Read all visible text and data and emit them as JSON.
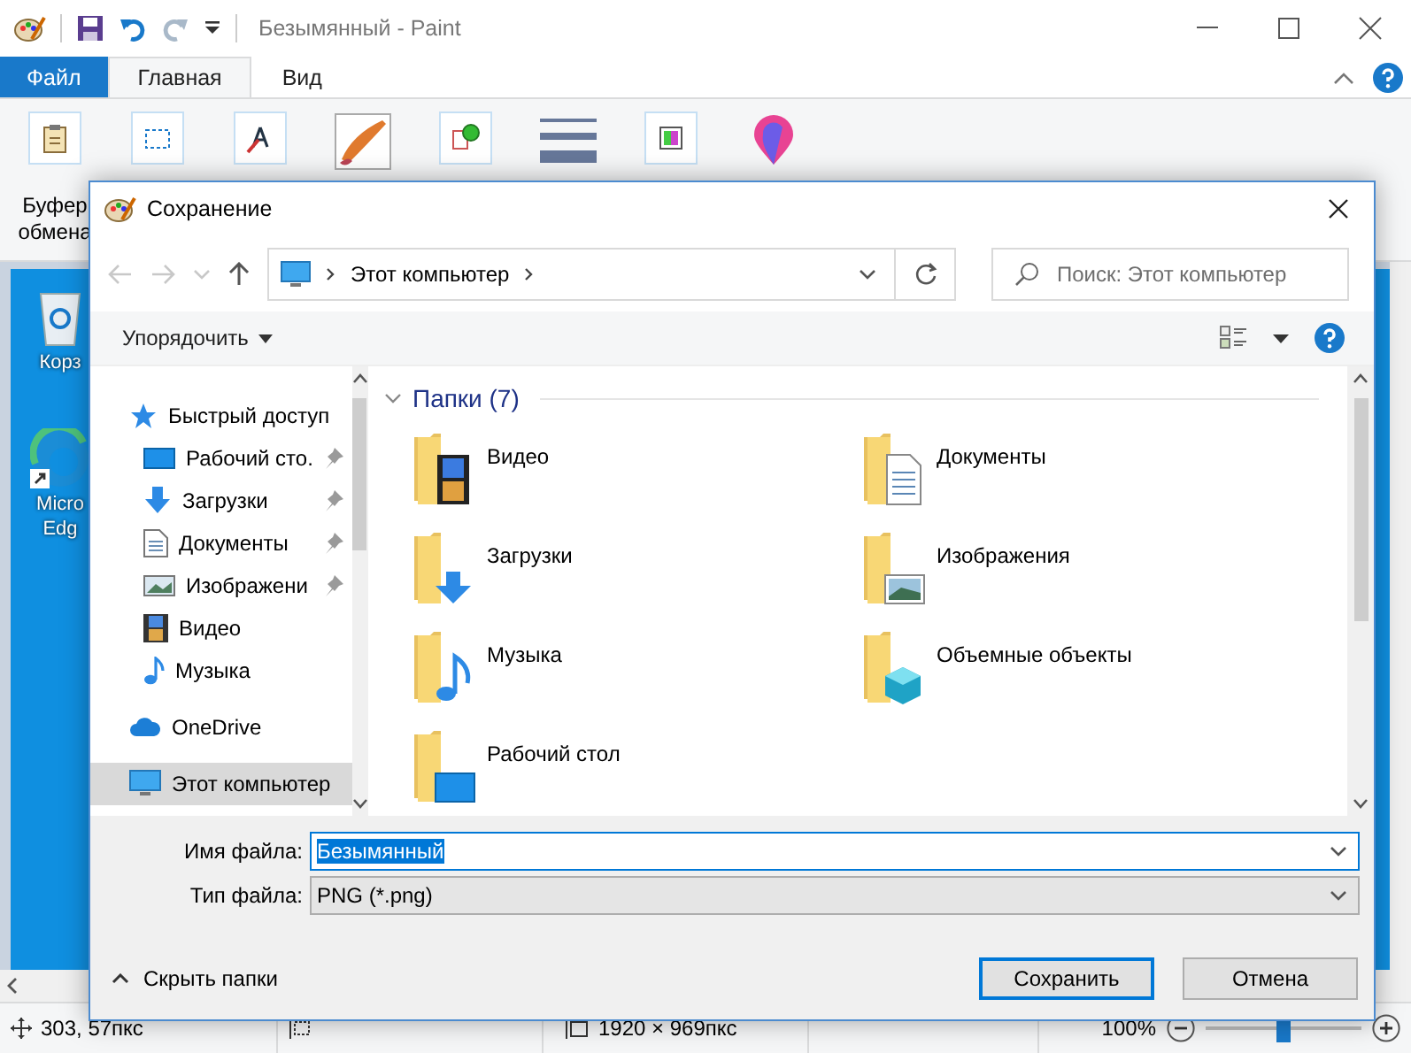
{
  "paint": {
    "title": "Безымянный - Paint",
    "tabs": [
      {
        "label": "Файл",
        "kind": "file",
        "selected": false
      },
      {
        "label": "Главная",
        "kind": "tab",
        "selected": true
      },
      {
        "label": "Вид",
        "kind": "tab",
        "selected": false
      }
    ],
    "ribbon_groups": [
      {
        "kind": "clipboard",
        "label": "Буфер обмена"
      },
      {
        "kind": "select"
      },
      {
        "kind": "tools"
      },
      {
        "kind": "brush"
      },
      {
        "kind": "shapes"
      },
      {
        "kind": "thickness"
      },
      {
        "kind": "colors"
      },
      {
        "kind": "paint3d"
      }
    ],
    "desktop_icons": [
      {
        "kind": "bin",
        "label": "Корз"
      },
      {
        "kind": "edge",
        "label": "Micro Edg"
      }
    ],
    "status_bar": {
      "cursor": "303, 57пкс",
      "canvas_size": "1920 × 969пкс",
      "zoom": "100%",
      "zoom_slider": {
        "level": 0.5
      }
    }
  },
  "dialog": {
    "title": "Сохранение",
    "address": "Этот компьютер",
    "search": {
      "placeholder": "Поиск: Этот компьютер"
    },
    "organize": "Упорядочить",
    "nav_tree": [
      {
        "label": "Быстрый доступ",
        "kind": "star",
        "selected": false,
        "children": [
          {
            "label": "Рабочий сто.",
            "kind": "desktop",
            "pinned": true,
            "selected": false
          },
          {
            "label": "Загрузки",
            "kind": "download",
            "pinned": true,
            "selected": false
          },
          {
            "label": "Документы",
            "kind": "document",
            "pinned": true,
            "selected": false
          },
          {
            "label": "Изображени",
            "kind": "pictures",
            "pinned": true,
            "selected": false
          },
          {
            "label": "Видео",
            "kind": "video",
            "pinned": false,
            "selected": false
          },
          {
            "label": "Музыка",
            "kind": "music",
            "pinned": false,
            "selected": false
          }
        ]
      },
      {
        "label": "OneDrive",
        "kind": "cloud",
        "selected": false
      },
      {
        "label": "Этот компьютер",
        "kind": "computer",
        "selected": true
      }
    ],
    "section": {
      "label": "Папки (7)",
      "expanded": true
    },
    "folders": [
      {
        "label": "Видео",
        "kind": "video"
      },
      {
        "label": "Документы",
        "kind": "document"
      },
      {
        "label": "Загрузки",
        "kind": "download"
      },
      {
        "label": "Изображения",
        "kind": "pictures"
      },
      {
        "label": "Музыка",
        "kind": "music"
      },
      {
        "label": "Объемные объекты",
        "kind": "objects3d"
      },
      {
        "label": "Рабочий стол",
        "kind": "desktop"
      }
    ],
    "file_name": {
      "label": "Имя файла:",
      "value": "Безымянный",
      "selected": true
    },
    "file_type": {
      "label": "Тип файла:",
      "value": "PNG (*.png)"
    },
    "hide_folders": "Скрыть папки",
    "buttons": [
      {
        "label": "Сохранить",
        "default": true
      },
      {
        "label": "Отмена",
        "default": false
      }
    ]
  }
}
